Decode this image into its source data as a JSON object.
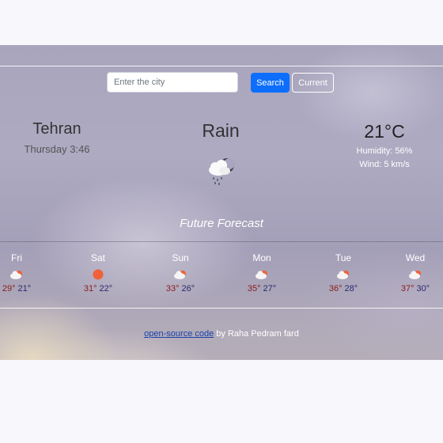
{
  "search": {
    "placeholder": "Enter the city",
    "search_label": "Search",
    "current_label": "Current"
  },
  "current": {
    "city": "Tehran",
    "datetime": "Thursday 3:46",
    "description": "Rain",
    "icon": "rain-cloud-night-icon",
    "temperature": "21°C",
    "humidity": "Humidity: 56%",
    "wind": "Wind: 5 km/s"
  },
  "forecast": {
    "title": "Future Forecast",
    "days": [
      {
        "day": "Fri",
        "icon": "cloud-sun-icon",
        "max": "29°",
        "min": "21°"
      },
      {
        "day": "Sat",
        "icon": "sun-icon",
        "max": "31°",
        "min": "22°"
      },
      {
        "day": "Sun",
        "icon": "cloud-sun-icon",
        "max": "33°",
        "min": "26°"
      },
      {
        "day": "Mon",
        "icon": "cloud-sun-icon",
        "max": "35°",
        "min": "27°"
      },
      {
        "day": "Tue",
        "icon": "cloud-sun-icon",
        "max": "36°",
        "min": "28°"
      },
      {
        "day": "Wed",
        "icon": "cloud-sun-icon",
        "max": "37°",
        "min": "30°"
      }
    ]
  },
  "footer": {
    "link_text": "open-source code",
    "text": "by Raha Pedram fard"
  },
  "colors": {
    "primary": "#0d6efd",
    "temp_max": "#8a1c1c",
    "temp_min": "#2a2a6a",
    "sun": "#f0613a"
  }
}
